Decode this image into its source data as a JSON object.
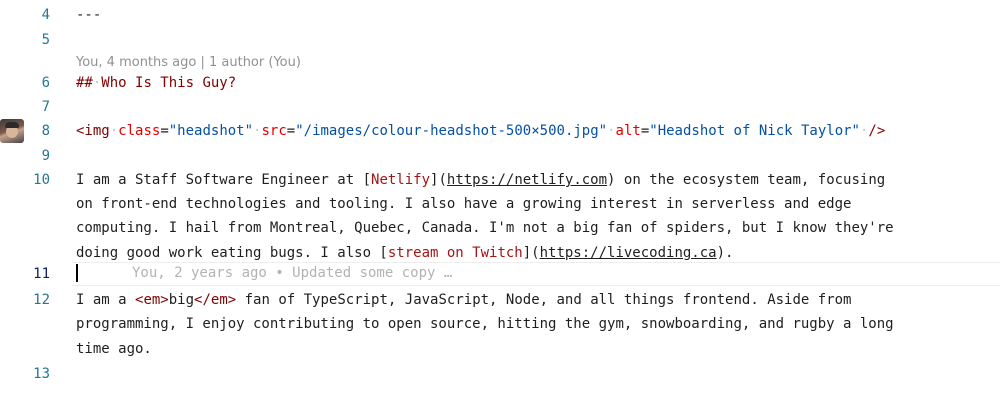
{
  "line_numbers": {
    "l4": "4",
    "l5": "5",
    "l6": "6",
    "l7": "7",
    "l8": "8",
    "l9": "9",
    "l10": "10",
    "l11": "11",
    "l12": "12",
    "l13": "13"
  },
  "codelens": "You, 4 months ago | 1 author (You)",
  "inline_blame": "You, 2 years ago • Updated some copy …",
  "tokens": {
    "frontmatter_sep": "---",
    "heading_marker": "##",
    "heading_text": "Who Is This Guy?",
    "img_open": "<img",
    "attr_class": "class",
    "val_class": "\"headshot\"",
    "attr_src": "src",
    "val_src": "\"/images/colour-headshot-500×500.jpg\"",
    "attr_alt": "alt",
    "val_alt": "\"Headshot of Nick Taylor\"",
    "img_close": "/>",
    "p1_before": "I am a Staff Software Engineer at [",
    "p1_link1_text": "Netlify",
    "p1_link1_mid": "](",
    "p1_link1_url": "https://netlify.com",
    "p1_after1": ") on the ecosystem team, focusing",
    "p1_l2": "on front-end technologies and tooling. I also have a growing interest in serverless and edge",
    "p1_l3": "computing. I hail from Montreal, Quebec, Canada. I'm not a big fan of spiders, but I know they're",
    "p1_l4_before": "doing good work eating bugs. I also [",
    "p1_link2_text": "stream on Twitch",
    "p1_link2_mid": "](",
    "p1_link2_url": "https://livecoding.ca",
    "p1_l4_after": ").",
    "p2_before": "I am a ",
    "em_open": "<em>",
    "em_text": "big",
    "em_close": "</em>",
    "p2_after": " fan of TypeScript, JavaScript, Node, and all things frontend. Aside from",
    "p2_l2": "programming, I enjoy contributing to open source, hitting the gym, snowboarding, and rugby a long",
    "p2_l3": "time ago."
  },
  "colors": {
    "line_number": "#237893",
    "line_number_active": "#0b216f",
    "tag": "#800000",
    "attribute": "#e50000",
    "string": "#0451a5",
    "link_text": "#a31515",
    "codelens": "#919191"
  },
  "icons": [
    "author-avatar"
  ]
}
